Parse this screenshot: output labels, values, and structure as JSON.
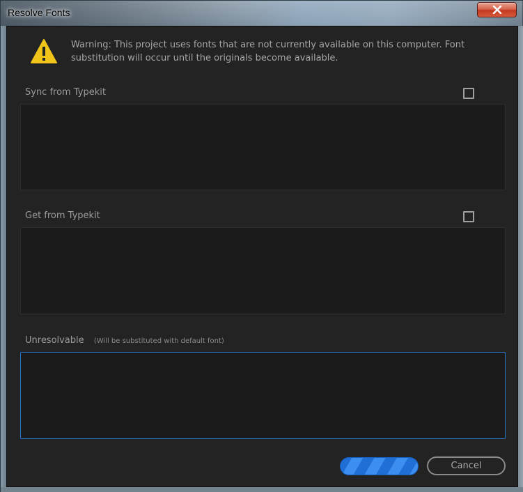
{
  "window": {
    "title": "Resolve Fonts"
  },
  "warning": {
    "text": "Warning: This project uses fonts that are not currently available on this computer. Font substitution will occur until the originals become available.",
    "icon": "warning-icon",
    "icon_color": "#f0c419"
  },
  "sections": {
    "sync": {
      "label": "Sync from Typekit",
      "checked": false
    },
    "get": {
      "label": "Get from Typekit",
      "checked": false
    },
    "unresolvable": {
      "label": "Unresolvable",
      "note": "(Will be substituted with default font)"
    }
  },
  "buttons": {
    "ok_label": "",
    "cancel_label": "Cancel"
  },
  "colors": {
    "accent": "#2a73c4",
    "ok_button": "#2f80e6",
    "close_button": "#c7432a"
  }
}
